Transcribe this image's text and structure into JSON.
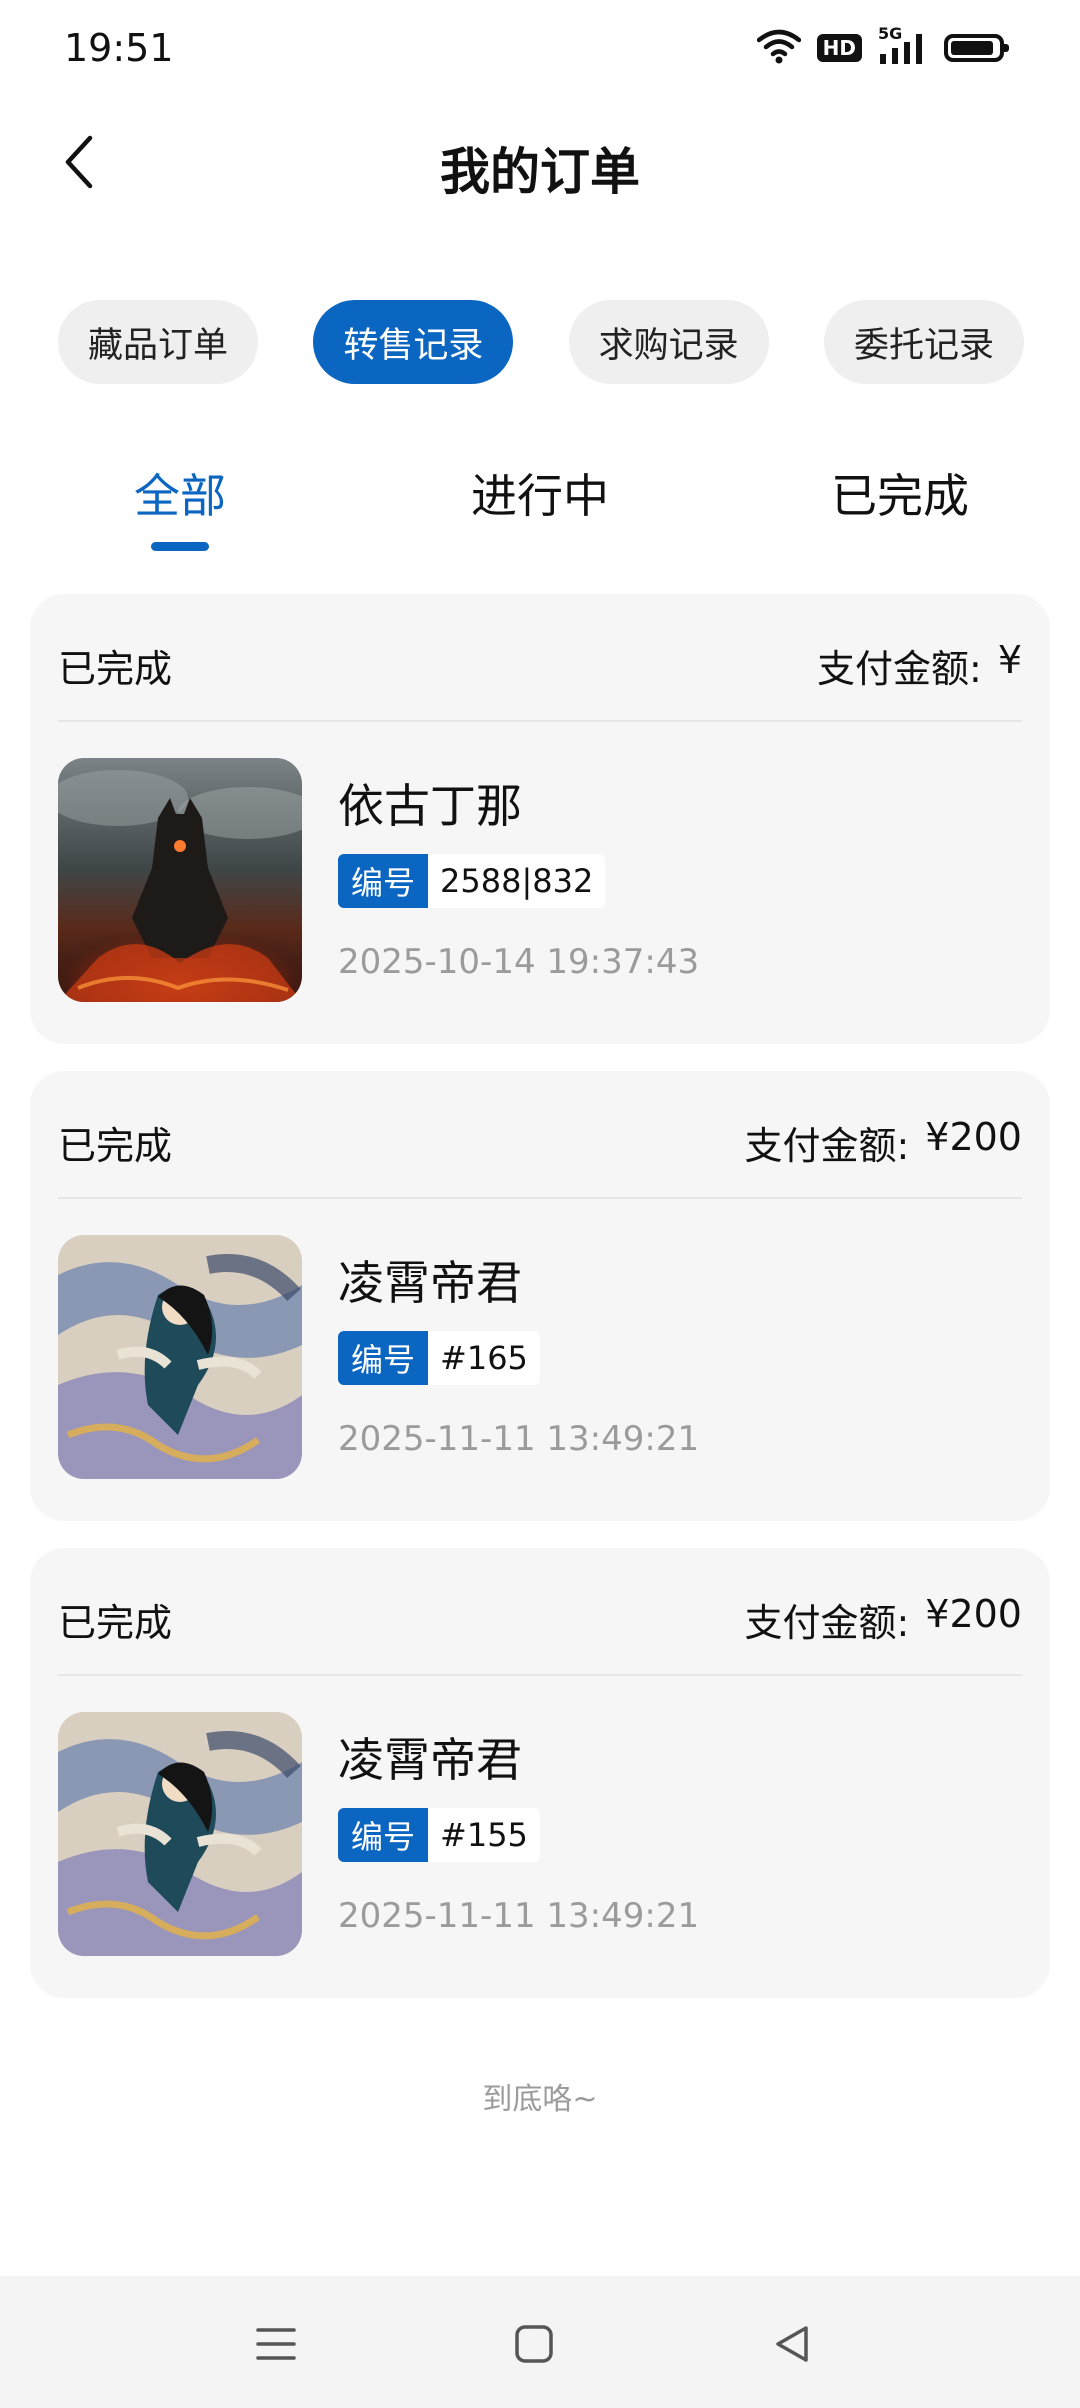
{
  "status_bar": {
    "time": "19:51",
    "hd_label": "HD",
    "network_label": "5G",
    "icons": [
      "wifi-icon",
      "hd-icon",
      "signal-5g-icon",
      "battery-icon"
    ],
    "battery_level": 0.92
  },
  "header": {
    "title": "我的订单",
    "back_icon": "chevron-left-icon"
  },
  "category_tabs": [
    {
      "label": "藏品订单",
      "active": false
    },
    {
      "label": "转售记录",
      "active": true
    },
    {
      "label": "求购记录",
      "active": false
    },
    {
      "label": "委托记录",
      "active": false
    }
  ],
  "status_tabs": [
    {
      "label": "全部",
      "active": true
    },
    {
      "label": "进行中",
      "active": false
    },
    {
      "label": "已完成",
      "active": false
    }
  ],
  "orders": [
    {
      "status": "已完成",
      "amount_label": "支付金额:",
      "amount": "¥",
      "name": "依古丁那",
      "serial_tag": "编号",
      "serial": "2588|832",
      "time": "2025-10-14 19:37:43",
      "thumb": "dark-demon-artwork"
    },
    {
      "status": "已完成",
      "amount_label": "支付金额:",
      "amount": "¥200",
      "name": "凌霄帝君",
      "serial_tag": "编号",
      "serial": "#165",
      "time": "2025-11-11 13:49:21",
      "thumb": "immortal-artwork"
    },
    {
      "status": "已完成",
      "amount_label": "支付金额:",
      "amount": "¥200",
      "name": "凌霄帝君",
      "serial_tag": "编号",
      "serial": "#155",
      "time": "2025-11-11 13:49:21",
      "thumb": "immortal-artwork"
    }
  ],
  "end_hint": "到底咯~",
  "nav_bar": {
    "icons": [
      "menu-icon",
      "home-square-icon",
      "back-triangle-icon"
    ]
  },
  "colors": {
    "accent": "#0b66c2",
    "card_bg": "#f6f6f6",
    "pill_bg": "#efefef",
    "muted_text": "#9b9b9b"
  }
}
